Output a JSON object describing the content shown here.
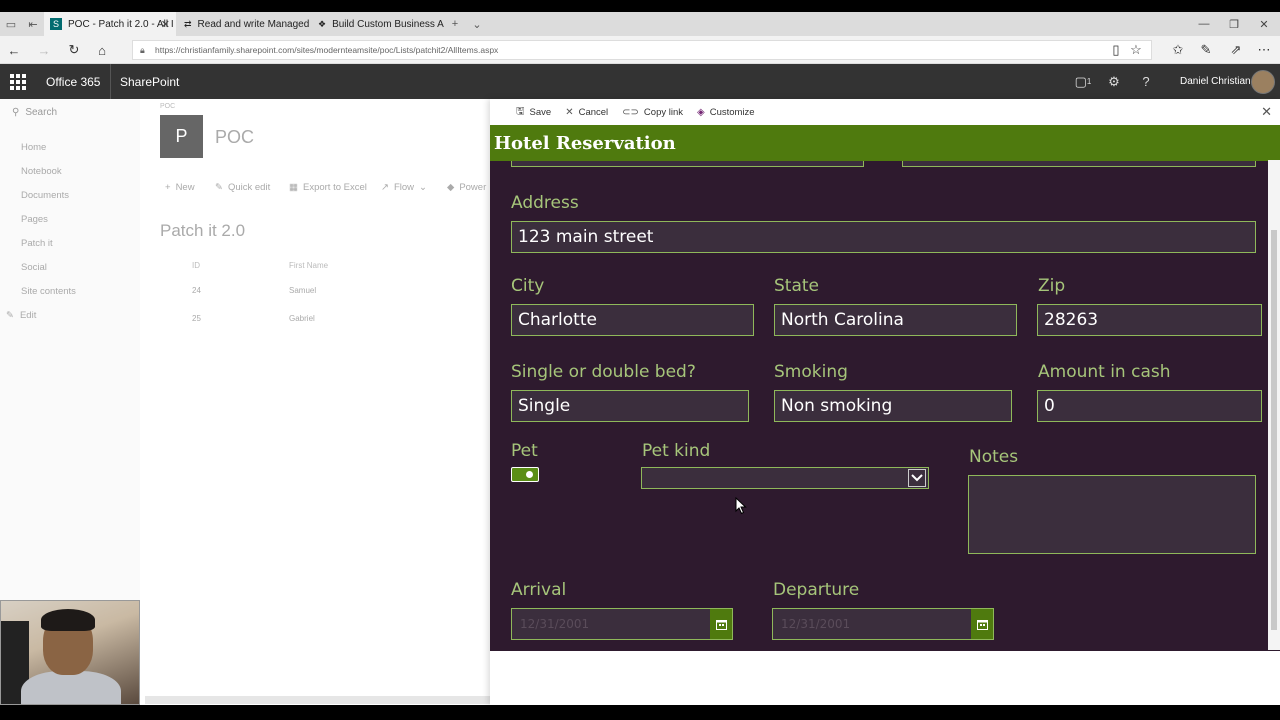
{
  "browser": {
    "tabs": [
      {
        "title": "POC - Patch it 2.0 - All I"
      },
      {
        "title": "Read and write Managed M"
      },
      {
        "title": "Build Custom Business App"
      }
    ],
    "url": "https://christianfamily.sharepoint.com/sites/modernteamsite/poc/Lists/patchit2/AllItems.aspx"
  },
  "suite": {
    "brand": "Office 365",
    "app": "SharePoint",
    "notification_count": "1",
    "user_name": "Daniel Christian"
  },
  "sharepoint": {
    "search_placeholder": "Search",
    "nav": [
      "Home",
      "Notebook",
      "Documents",
      "Pages",
      "Patch it",
      "Social",
      "Site contents"
    ],
    "edit_label": "Edit",
    "site_mini": "POC",
    "site_logo_letter": "P",
    "site_title": "POC",
    "commands": [
      "New",
      "Quick edit",
      "Export to Excel",
      "Flow",
      "Power"
    ],
    "list_title": "Patch it 2.0",
    "columns": [
      "ID",
      "First Name"
    ],
    "rows": [
      {
        "id": "24",
        "first_name": "Samuel"
      },
      {
        "id": "25",
        "first_name": "Gabriel"
      }
    ]
  },
  "panel": {
    "commands": {
      "save": "Save",
      "cancel": "Cancel",
      "copy_link": "Copy link",
      "customize": "Customize"
    }
  },
  "form": {
    "title": "Hotel Reservation",
    "address": {
      "label": "Address",
      "value": "123 main street"
    },
    "city": {
      "label": "City",
      "value": "Charlotte"
    },
    "state": {
      "label": "State",
      "value": "North Carolina"
    },
    "zip": {
      "label": "Zip",
      "value": "28263"
    },
    "bed": {
      "label": "Single or double bed?",
      "value": "Single"
    },
    "smoking": {
      "label": "Smoking",
      "value": "Non smoking"
    },
    "cash": {
      "label": "Amount in cash",
      "value": "0"
    },
    "pet": {
      "label": "Pet",
      "checked": true
    },
    "pet_kind": {
      "label": "Pet kind",
      "value": ""
    },
    "notes": {
      "label": "Notes",
      "value": ""
    },
    "arrival": {
      "label": "Arrival",
      "placeholder": "12/31/2001"
    },
    "departure": {
      "label": "Departure",
      "placeholder": "12/31/2001"
    }
  },
  "colors": {
    "header_green": "#4f7a0e",
    "form_bg": "#2e1a2e",
    "label_green": "#a6c57a"
  }
}
